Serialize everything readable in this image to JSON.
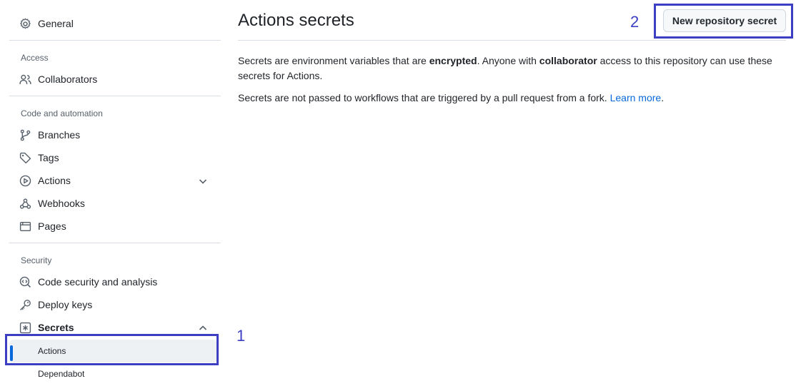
{
  "sidebar": {
    "general": "General",
    "access_heading": "Access",
    "collaborators": "Collaborators",
    "code_heading": "Code and automation",
    "branches": "Branches",
    "tags": "Tags",
    "actions": "Actions",
    "webhooks": "Webhooks",
    "pages": "Pages",
    "security_heading": "Security",
    "code_security": "Code security and analysis",
    "deploy_keys": "Deploy keys",
    "secrets": "Secrets",
    "secrets_sub": {
      "actions": "Actions",
      "dependabot": "Dependabot"
    }
  },
  "annotations": {
    "one": "1",
    "two": "2"
  },
  "main": {
    "title": "Actions secrets",
    "new_secret_button": "New repository secret",
    "para1": {
      "t1": "Secrets are environment variables that are ",
      "b1": "encrypted",
      "t2": ". Anyone with ",
      "b2": "collaborator",
      "t3": " access to this repository can use these secrets for Actions."
    },
    "para2": {
      "t1": "Secrets are not passed to workflows that are triggered by a pull request from a fork. ",
      "link": "Learn more",
      "t2": "."
    }
  },
  "colors": {
    "accent": "#0969da",
    "annotation": "#3c3fc2",
    "active_bg": "#eef1f4"
  },
  "icons": [
    "gear-icon",
    "people-icon",
    "git-branch-icon",
    "tag-icon",
    "play-icon",
    "chevron-down-icon",
    "webhook-icon",
    "browser-icon",
    "codescan-icon",
    "key-icon",
    "asterisk-icon",
    "chevron-up-icon"
  ]
}
